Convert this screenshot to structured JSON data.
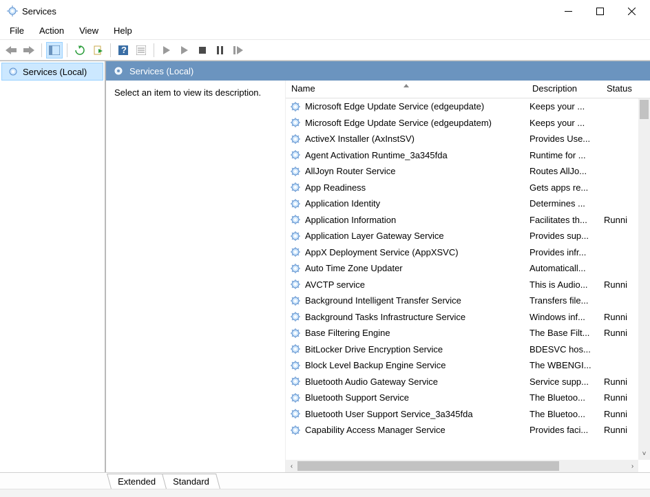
{
  "window": {
    "title": "Services"
  },
  "menu": {
    "file": "File",
    "action": "Action",
    "view": "View",
    "help": "Help"
  },
  "nav": {
    "root_label": "Services (Local)"
  },
  "content": {
    "header": "Services (Local)",
    "hint": "Select an item to view its description."
  },
  "columns": {
    "name": "Name",
    "description": "Description",
    "status": "Status"
  },
  "tabs": {
    "extended": "Extended",
    "standard": "Standard"
  },
  "services": [
    {
      "name": "Microsoft Edge Update Service (edgeupdate)",
      "desc": "Keeps your ...",
      "status": ""
    },
    {
      "name": "Microsoft Edge Update Service (edgeupdatem)",
      "desc": "Keeps your ...",
      "status": ""
    },
    {
      "name": "ActiveX Installer (AxInstSV)",
      "desc": "Provides Use...",
      "status": ""
    },
    {
      "name": "Agent Activation Runtime_3a345fda",
      "desc": "Runtime for ...",
      "status": ""
    },
    {
      "name": "AllJoyn Router Service",
      "desc": "Routes AllJo...",
      "status": ""
    },
    {
      "name": "App Readiness",
      "desc": "Gets apps re...",
      "status": ""
    },
    {
      "name": "Application Identity",
      "desc": "Determines ...",
      "status": ""
    },
    {
      "name": "Application Information",
      "desc": "Facilitates th...",
      "status": "Runni"
    },
    {
      "name": "Application Layer Gateway Service",
      "desc": "Provides sup...",
      "status": ""
    },
    {
      "name": "AppX Deployment Service (AppXSVC)",
      "desc": "Provides infr...",
      "status": ""
    },
    {
      "name": "Auto Time Zone Updater",
      "desc": "Automaticall...",
      "status": ""
    },
    {
      "name": "AVCTP service",
      "desc": "This is Audio...",
      "status": "Runni"
    },
    {
      "name": "Background Intelligent Transfer Service",
      "desc": "Transfers file...",
      "status": ""
    },
    {
      "name": "Background Tasks Infrastructure Service",
      "desc": "Windows inf...",
      "status": "Runni"
    },
    {
      "name": "Base Filtering Engine",
      "desc": "The Base Filt...",
      "status": "Runni"
    },
    {
      "name": "BitLocker Drive Encryption Service",
      "desc": "BDESVC hos...",
      "status": ""
    },
    {
      "name": "Block Level Backup Engine Service",
      "desc": "The WBENGI...",
      "status": ""
    },
    {
      "name": "Bluetooth Audio Gateway Service",
      "desc": "Service supp...",
      "status": "Runni"
    },
    {
      "name": "Bluetooth Support Service",
      "desc": "The Bluetoo...",
      "status": "Runni"
    },
    {
      "name": "Bluetooth User Support Service_3a345fda",
      "desc": "The Bluetoo...",
      "status": "Runni"
    },
    {
      "name": "Capability Access Manager Service",
      "desc": "Provides faci...",
      "status": "Runni"
    }
  ]
}
